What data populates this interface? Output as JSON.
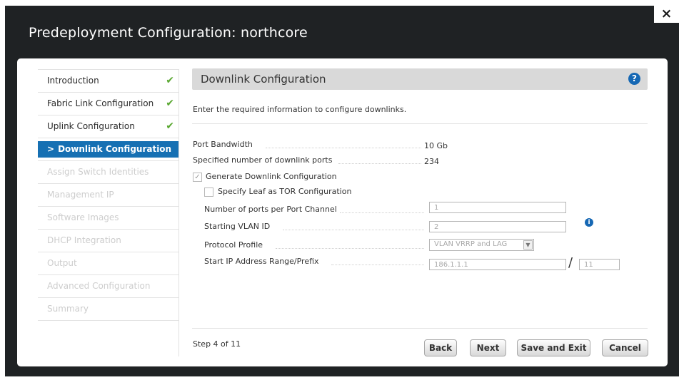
{
  "dialog": {
    "title": "Predeployment Configuration: northcore",
    "close_label": "×"
  },
  "sidebar": {
    "items": [
      {
        "label": "Introduction",
        "state": "done"
      },
      {
        "label": "Fabric Link Configuration",
        "state": "done"
      },
      {
        "label": "Uplink Configuration",
        "state": "done"
      },
      {
        "label": "Downlink Configuration",
        "state": "active"
      },
      {
        "label": "Assign Switch Identities",
        "state": "disabled"
      },
      {
        "label": "Management IP",
        "state": "disabled"
      },
      {
        "label": "Software Images",
        "state": "disabled"
      },
      {
        "label": "DHCP Integration",
        "state": "disabled"
      },
      {
        "label": "Output",
        "state": "disabled"
      },
      {
        "label": "Advanced Configuration",
        "state": "disabled"
      },
      {
        "label": "Summary",
        "state": "disabled"
      }
    ],
    "check_glyph": "✔",
    "active_arrow": ">"
  },
  "main": {
    "section_title": "Downlink Configuration",
    "help_glyph": "?",
    "intro": "Enter the required information to configure downlinks.",
    "port_bandwidth": {
      "label": "Port Bandwidth",
      "value": "10 Gb"
    },
    "downlink_ports": {
      "label": "Specified number of downlink ports",
      "value": "234"
    },
    "generate_config": {
      "label": "Generate Downlink Configuration",
      "checked": true
    },
    "leaf_as_tor": {
      "label": "Specify Leaf as TOR Configuration",
      "checked": false
    },
    "ports_per_channel": {
      "label": "Number of ports per Port Channel",
      "value": "1"
    },
    "starting_vlan": {
      "label": "Starting VLAN ID",
      "value": "2"
    },
    "protocol_profile": {
      "label": "Protocol Profile",
      "value": "VLAN VRRP and LAG"
    },
    "ip_range": {
      "label": "Start IP Address Range/Prefix",
      "value": "186.1.1.1",
      "separator": "/",
      "prefix": "11"
    },
    "info_glyph": "i"
  },
  "footer": {
    "step": "Step 4 of 11",
    "back": "Back",
    "next": "Next",
    "save_exit": "Save and Exit",
    "cancel": "Cancel"
  },
  "colors": {
    "active_blue": "#1670b3",
    "check_green": "#5aa832",
    "title_bar": "#1f2224"
  }
}
